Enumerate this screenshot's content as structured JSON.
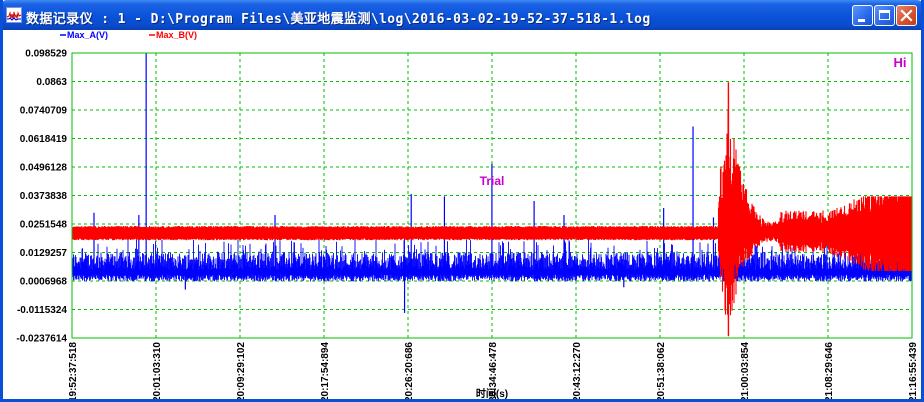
{
  "window": {
    "title": "数据记录仪 : 1 - D:\\Program Files\\美亚地震监测\\log\\2016-03-02-19-52-37-518-1.log",
    "icon": "waveform-app-icon"
  },
  "window_controls": {
    "minimize": "minimize-icon",
    "maximize": "maximize-icon",
    "close": "close-icon"
  },
  "colors": {
    "plot_bg": "#ffffff",
    "grid": "#00c000",
    "series_a": "#0000ff",
    "series_b": "#ff0000",
    "annotation": "#cc00cc",
    "frame": "#000000"
  },
  "chart_data": {
    "type": "line",
    "title": "",
    "xlabel": "时间(s)",
    "ylabel": "",
    "ylim": [
      -0.0237614,
      0.098529
    ],
    "yticks": [
      "0.098529",
      "0.0863",
      "0.0740709",
      "0.0618419",
      "0.0496128",
      "0.0373838",
      "0.0251548",
      "0.0129257",
      "0.0006968",
      "-0.0115324",
      "-0.0237614"
    ],
    "x_start": "19:52:37:518",
    "x_end": "21:16:55:439",
    "xticks": [
      "19:52:37:518",
      "20:01:03:310",
      "20:09:29:102",
      "20:17:54:894",
      "20:26:20:686",
      "20:34:46:478",
      "20:43:12:270",
      "20:51:38:062",
      "21:00:03:854",
      "21:08:29:646",
      "21:16:55:439"
    ],
    "grid": true,
    "legend": "top-left",
    "annotations": [
      {
        "text": "Trial",
        "x": "20:34:46",
        "y": 0.0373838,
        "color": "#cc00cc"
      },
      {
        "text": "Hi",
        "x": "21:16:30",
        "y": 0.091,
        "color": "#cc00cc"
      }
    ],
    "series": [
      {
        "name": "Max_A(V)",
        "color": "#0000ff",
        "baseline": 0.0055,
        "noise_low": 0.0005,
        "noise_high": 0.013,
        "spikes": [
          {
            "t": "20:00:04",
            "y": 0.0985
          },
          {
            "t": "19:54:50",
            "y": 0.03
          },
          {
            "t": "19:59:20",
            "y": 0.029
          },
          {
            "t": "20:13:00",
            "y": 0.029
          },
          {
            "t": "20:26:40",
            "y": 0.038
          },
          {
            "t": "20:30:00",
            "y": 0.037
          },
          {
            "t": "20:34:46",
            "y": 0.051
          },
          {
            "t": "20:39:00",
            "y": 0.035
          },
          {
            "t": "20:42:00",
            "y": 0.029
          },
          {
            "t": "20:52:00",
            "y": 0.032
          },
          {
            "t": "20:54:57",
            "y": 0.067
          },
          {
            "t": "20:57:00",
            "y": 0.028
          },
          {
            "t": "20:26:00",
            "y": -0.013
          },
          {
            "t": "20:04:00",
            "y": -0.003
          },
          {
            "t": "20:48:00",
            "y": -0.002
          }
        ]
      },
      {
        "name": "Max_B(V)",
        "color": "#ff0000",
        "baseline": 0.021,
        "band": [
          0.019,
          0.0235
        ],
        "event": {
          "start": "20:57:30",
          "peak": "20:58:30",
          "max": 0.086,
          "min": -0.023,
          "decay_end": "21:03:30"
        },
        "late_activity": {
          "start": "21:08:00",
          "end": "21:16:55",
          "max": 0.037,
          "min": 0.005
        }
      }
    ]
  }
}
